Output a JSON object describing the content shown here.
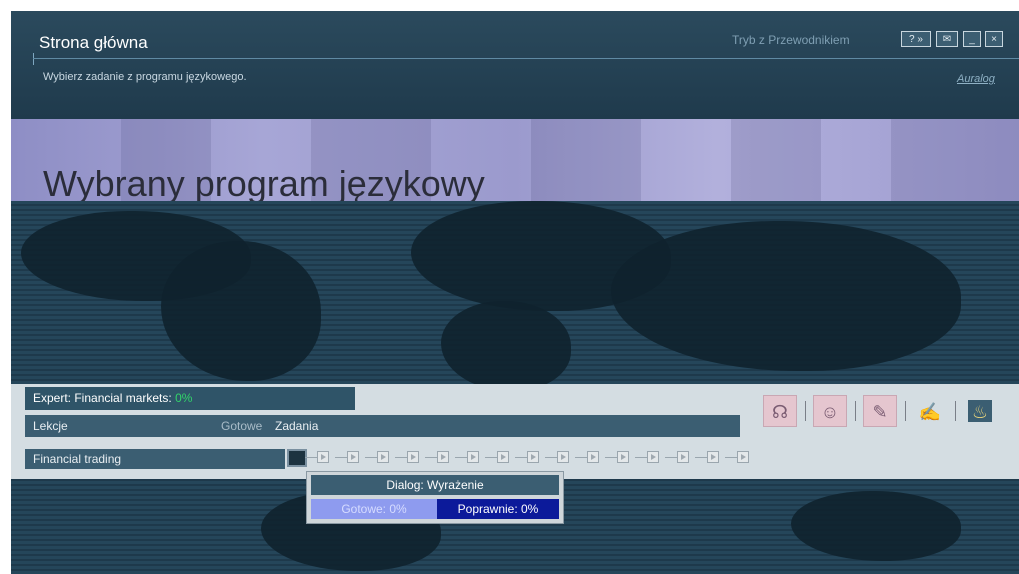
{
  "header": {
    "title": "Strona główna",
    "subtitle": "Wybierz zadanie z programu językowego.",
    "guide_mode": "Tryb z Przewodnikiem",
    "brand": "Auralog",
    "buttons": {
      "help": "? »",
      "mail": "✉",
      "minimize": "_",
      "close": "×"
    }
  },
  "banner": {
    "title": "Wybrany program językowy"
  },
  "program": {
    "name": "Expert: Financial markets:",
    "progress": "0%",
    "columns": {
      "lessons": "Lekcje",
      "done": "Gotowe",
      "tasks": "Zadania"
    },
    "lessons": [
      {
        "name": "Financial trading",
        "done": "",
        "task_count": 15
      }
    ]
  },
  "tools": [
    {
      "icon": "listen-icon"
    },
    {
      "icon": "speak-icon"
    },
    {
      "icon": "read-write-icon"
    },
    {
      "icon": "write-icon"
    },
    {
      "icon": "stats-icon"
    }
  ],
  "tooltip": {
    "title": "Dialog: Wyrażenie",
    "done": "Gotowe: 0%",
    "correct": "Poprawnie: 0%"
  },
  "colors": {
    "progress_green": "#32d46a",
    "correct_bg": "#0c1a9a",
    "done_bg": "#8e9bef"
  }
}
